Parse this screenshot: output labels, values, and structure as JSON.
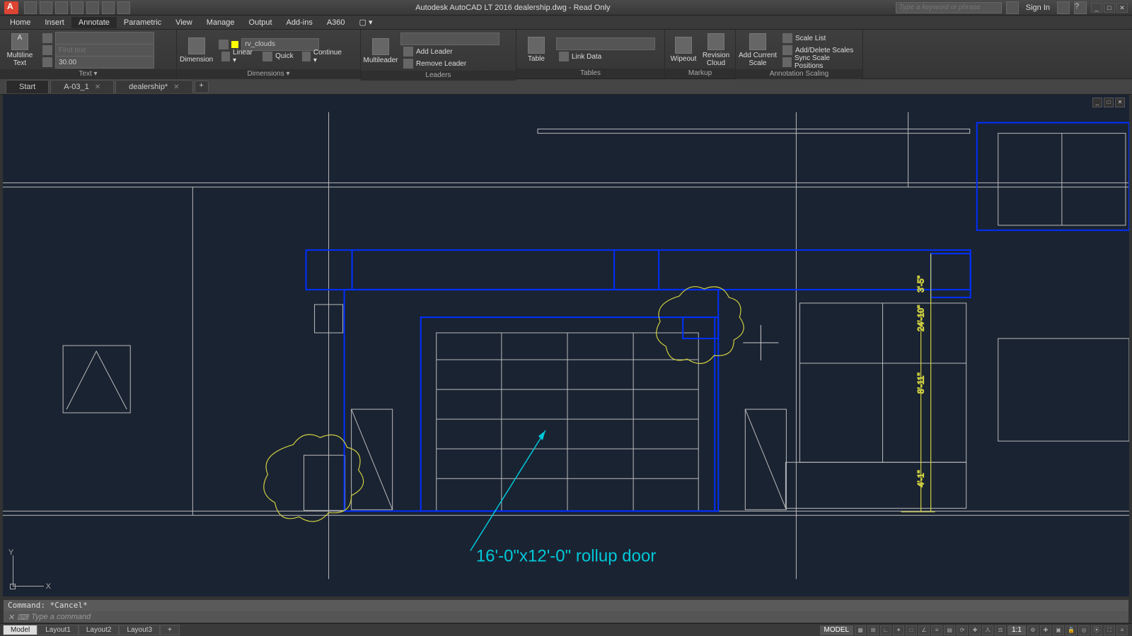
{
  "app": {
    "title": "Autodesk AutoCAD LT 2016   dealership.dwg - Read Only",
    "search_placeholder": "Type a keyword or phrase",
    "signin": "Sign In"
  },
  "menu": {
    "home": "Home",
    "insert": "Insert",
    "annotate": "Annotate",
    "parametric": "Parametric",
    "view": "View",
    "manage": "Manage",
    "output": "Output",
    "addins": "Add-ins",
    "a360": "A360"
  },
  "ribbon": {
    "text_panel": "Text ▾",
    "multiline": "Multiline Text",
    "find_ph": "Find text",
    "layer_name": "rv_clouds",
    "height_val": "30.00",
    "dim_panel": "Dimensions ▾",
    "dimension": "Dimension",
    "linear": "Linear ▾",
    "quick": "Quick",
    "continue": "Continue ▾",
    "leaders_panel": "Leaders",
    "multileader": "Multileader",
    "add_leader": "Add Leader",
    "remove_leader": "Remove Leader",
    "tables_panel": "Tables",
    "table": "Table",
    "link_data": "Link Data",
    "markup_panel": "Markup",
    "wipeout": "Wipeout",
    "rev_cloud": "Revision Cloud",
    "anno_panel": "Annotation Scaling",
    "add_scale": "Add Current Scale",
    "scale_list": "Scale List",
    "add_del": "Add/Delete Scales",
    "sync": "Sync Scale Positions"
  },
  "tabs": {
    "start": "Start",
    "t1": "A-03_1",
    "t2": "dealership*",
    "plus": "+"
  },
  "drawing": {
    "callout": "16'-0\"x12'-0\" rollup door",
    "dim1": "3'-5\"",
    "dim2": "24'-10\"",
    "dim3": "8'-11\"",
    "dim4": "4'-1\""
  },
  "wcs": {
    "y": "Y",
    "x": "X"
  },
  "cmd": {
    "history": "Command: *Cancel*",
    "prompt": "Type a command"
  },
  "layouts": {
    "model": "Model",
    "l1": "Layout1",
    "l2": "Layout2",
    "l3": "Layout3"
  },
  "status": {
    "model": "MODEL",
    "scale": "1:1"
  }
}
